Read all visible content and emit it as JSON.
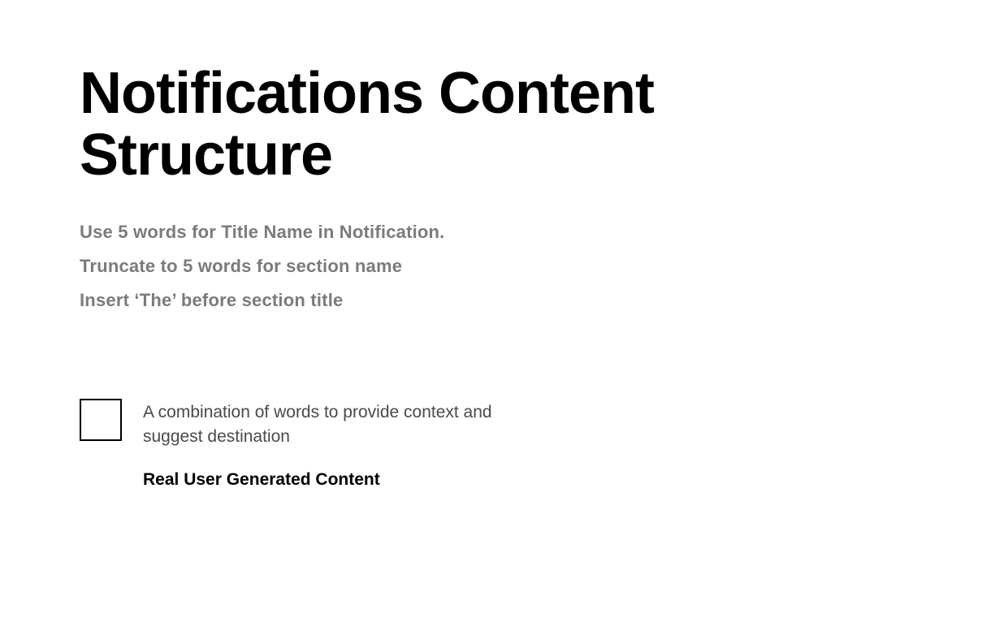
{
  "title": "Notifications Content Structure",
  "guidelines": {
    "item1": "Use 5 words for Title Name in Notification.",
    "item2": "Truncate to 5 words for section name",
    "item3": "Insert ‘The’ before section title"
  },
  "example": {
    "context_description": "A combination of words to provide context and suggest destination",
    "ugc_label": "Real User Generated Content"
  }
}
